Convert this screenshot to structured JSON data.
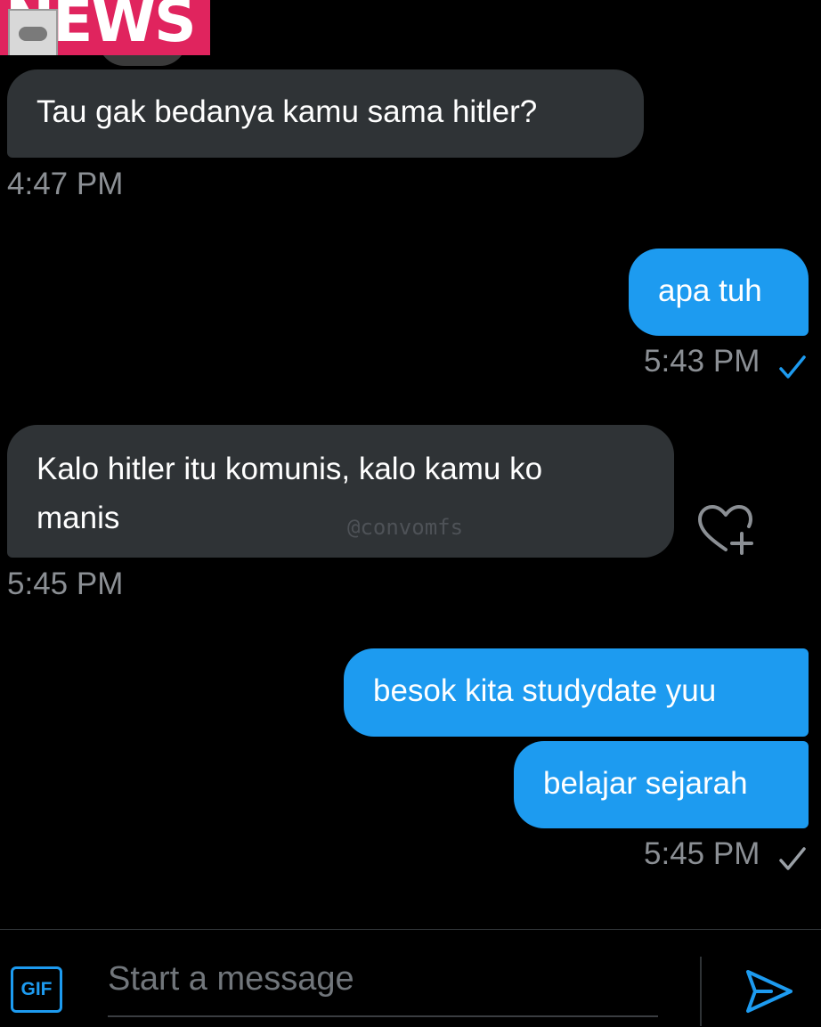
{
  "banner": {
    "text": "NEWS",
    "logo_text": "convomfs"
  },
  "messages": [
    {
      "direction": "in",
      "text": "Tau gak bedanya kamu sama hitler?",
      "time": "4:47 PM"
    },
    {
      "direction": "out",
      "text": "apa tuh",
      "time": "5:43 PM",
      "status": "read"
    },
    {
      "direction": "in",
      "text": "Kalo hitler itu komunis, kalo kamu ko manis",
      "line1": "Kalo hitler itu komunis, kalo kamu ko",
      "line2": "manis",
      "time": "5:45 PM"
    },
    {
      "direction": "out",
      "text": "besok kita studydate yuu"
    },
    {
      "direction": "out",
      "text": "belajar sejarah",
      "time": "5:45 PM",
      "status": "sent"
    }
  ],
  "watermark": "@convomfs",
  "composer": {
    "gif_label": "GIF",
    "placeholder": "Start a message"
  },
  "colors": {
    "accent": "#1d9bf0",
    "incoming_bubble": "#2f3336",
    "timestamp": "#8b8f94",
    "banner": "#e0245e"
  },
  "icons": {
    "react": "heart-plus-icon",
    "send": "send-icon",
    "read": "check-icon-blue",
    "sent": "check-icon-gray"
  }
}
